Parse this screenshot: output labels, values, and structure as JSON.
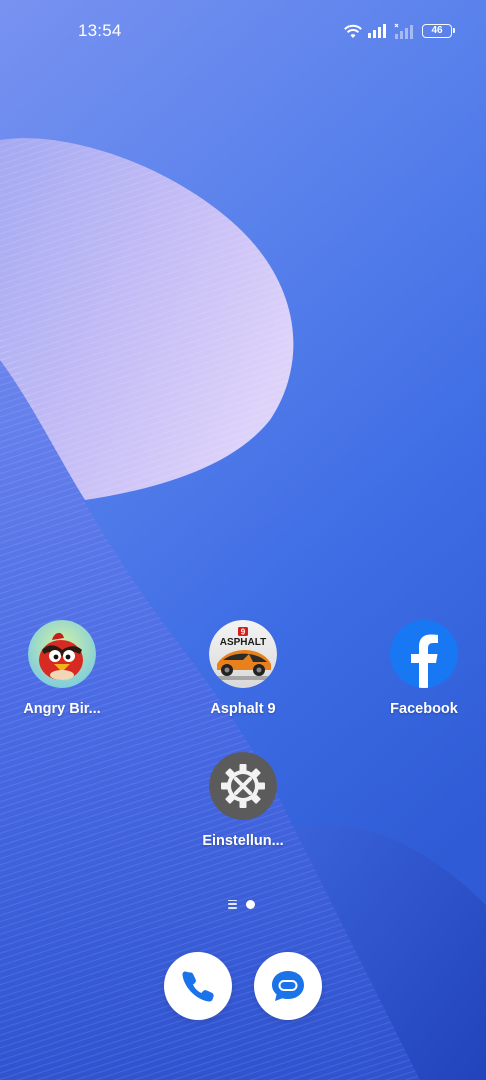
{
  "status_bar": {
    "time": "13:54",
    "battery_level": "46",
    "wifi_icon": "wifi-icon",
    "signal_icon": "signal-icon"
  },
  "apps": [
    {
      "label": "Angry Bir...",
      "icon": "angry-birds-icon"
    },
    {
      "label": "Asphalt 9",
      "icon": "asphalt-9-icon",
      "icon_text": "ASPHALT",
      "icon_badge": "9"
    },
    {
      "label": "Facebook",
      "icon": "facebook-icon",
      "icon_text": "f"
    },
    {
      "label": "Einstellun...",
      "icon": "settings-gear-icon"
    }
  ],
  "page_indicator": {
    "pages": 2,
    "current": 2
  },
  "dock": [
    {
      "app": "phone",
      "icon": "phone-icon"
    },
    {
      "app": "messages",
      "icon": "messages-icon"
    }
  ],
  "colors": {
    "wallpaper_top": "#6f8ff0",
    "wallpaper_mid": "#3f6fe6",
    "wallpaper_bottom": "#2d55c7",
    "wave_light": "#b9b2f3",
    "accent_blue": "#1a73e8",
    "facebook_blue": "#1877f2"
  }
}
